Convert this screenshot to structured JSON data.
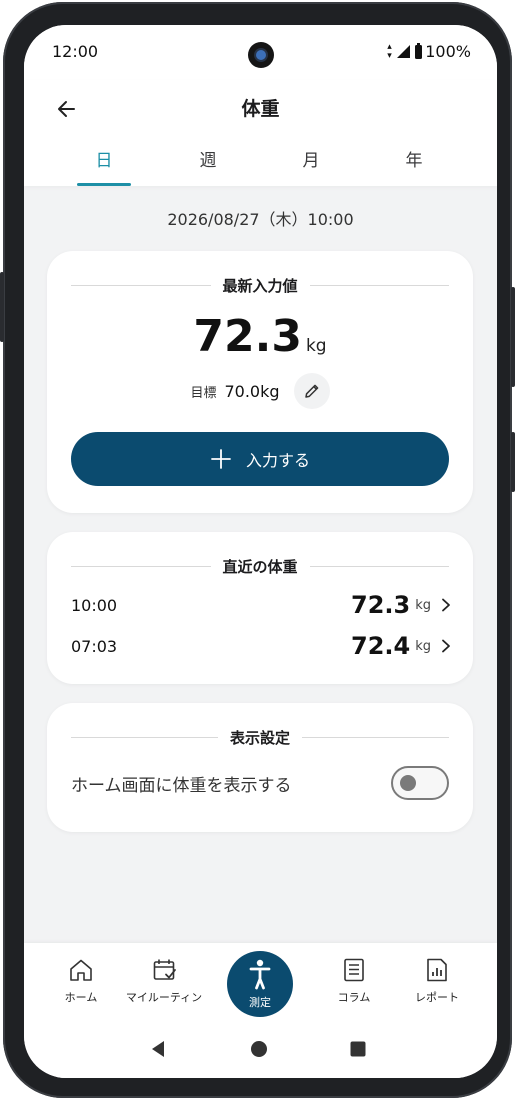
{
  "status_bar": {
    "time": "12:00",
    "battery": "100%"
  },
  "header": {
    "title": "体重",
    "tabs": [
      {
        "label": "日",
        "active": true
      },
      {
        "label": "週",
        "active": false
      },
      {
        "label": "月",
        "active": false
      },
      {
        "label": "年",
        "active": false
      }
    ]
  },
  "datetime": "2026/08/27（木）10:00",
  "latest": {
    "heading": "最新入力値",
    "value": "72.3",
    "unit": "kg",
    "goal_label": "目標",
    "goal_value": "70.0kg",
    "input_button_label": "入力する"
  },
  "recent": {
    "heading": "直近の体重",
    "rows": [
      {
        "time": "10:00",
        "value": "72.3",
        "unit": "kg"
      },
      {
        "time": "07:03",
        "value": "72.4",
        "unit": "kg"
      }
    ]
  },
  "display_settings": {
    "heading": "表示設定",
    "toggle_label": "ホーム画面に体重を表示する",
    "toggle_on": false
  },
  "bottom_nav": {
    "items": [
      {
        "label": "ホーム",
        "icon": "home-icon"
      },
      {
        "label": "マイルーティン",
        "icon": "calendar-check-icon"
      },
      {
        "label": "測定",
        "icon": "person-icon",
        "active": true
      },
      {
        "label": "コラム",
        "icon": "article-icon"
      },
      {
        "label": "レポート",
        "icon": "report-icon"
      }
    ]
  },
  "colors": {
    "accent": "#1d8fa6",
    "primary_button": "#0b4b6f",
    "background": "#f2f3f4"
  }
}
